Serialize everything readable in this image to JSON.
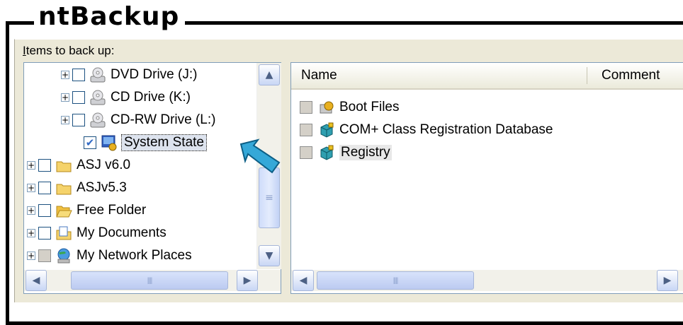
{
  "title": "ntBackup",
  "items_label": {
    "accel": "I",
    "rest": "tems to back up:"
  },
  "tree": [
    {
      "label": "DVD Drive (J:)",
      "checked": false,
      "icon": "cd-drive-icon"
    },
    {
      "label": "CD Drive (K:)",
      "checked": false,
      "icon": "cd-drive-icon"
    },
    {
      "label": "CD-RW Drive (L:)",
      "checked": false,
      "icon": "cd-drive-icon"
    },
    {
      "label": "System State",
      "checked": true,
      "icon": "system-state-icon",
      "selected": true
    },
    {
      "label": "ASJ v6.0",
      "checked": false,
      "icon": "folder-icon"
    },
    {
      "label": "ASJv5.3",
      "checked": false,
      "icon": "folder-icon"
    },
    {
      "label": "Free Folder",
      "checked": false,
      "icon": "open-folder-icon"
    },
    {
      "label": "My Documents",
      "checked": false,
      "icon": "my-documents-icon"
    },
    {
      "label": "My Network Places",
      "checked": false,
      "icon": "network-places-icon"
    }
  ],
  "list": {
    "columns": [
      "Name",
      "Comment"
    ],
    "rows": [
      {
        "label": "Boot Files",
        "icon": "boot-files-icon"
      },
      {
        "label": "COM+ Class Registration Database",
        "icon": "component-icon"
      },
      {
        "label": "Registry",
        "icon": "component-icon"
      }
    ]
  },
  "colors": {
    "accent": "#316ac5",
    "check": "#21a121",
    "pointer": "#35a8d8"
  }
}
